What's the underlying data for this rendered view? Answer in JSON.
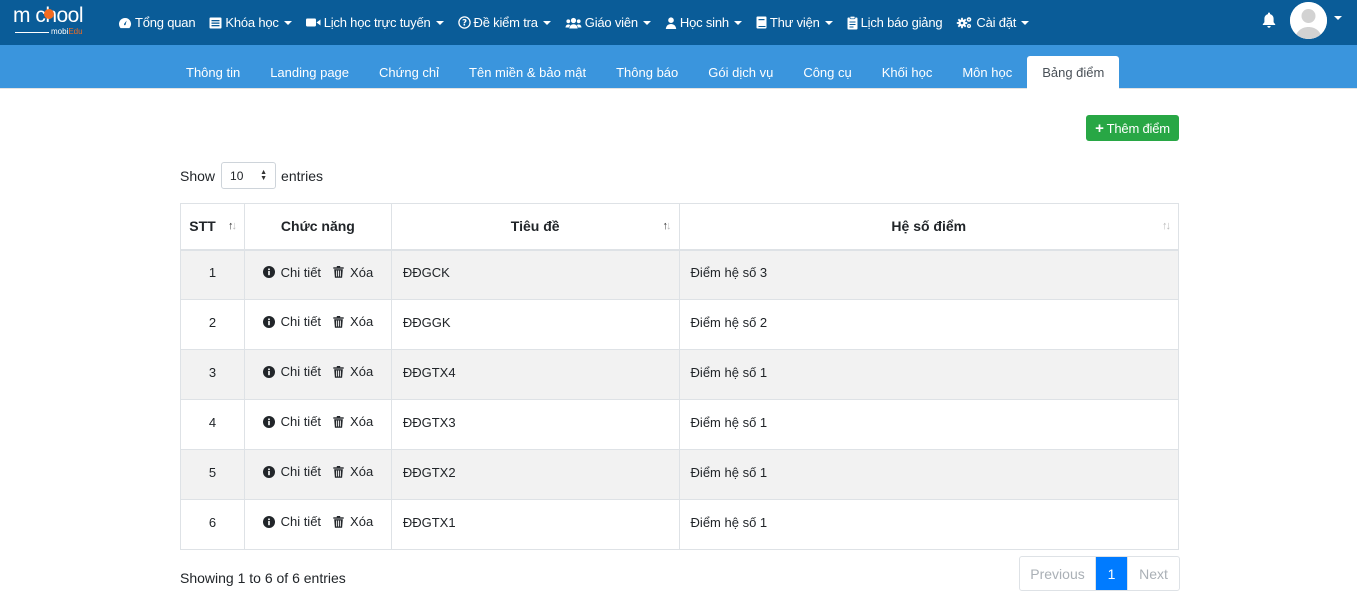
{
  "logo": {
    "text": "m chool",
    "sub_prefix": "",
    "sub_brand_a": "mobi",
    "sub_brand_b": "Edu"
  },
  "topnav": [
    {
      "label": "Tổng quan",
      "icon": "dashboard-icon",
      "dropdown": false
    },
    {
      "label": "Khóa học",
      "icon": "list-icon",
      "dropdown": true
    },
    {
      "label": "Lịch học trực tuyến",
      "icon": "video-icon",
      "dropdown": true
    },
    {
      "label": "Đề kiểm tra",
      "icon": "question-circle-icon",
      "dropdown": true
    },
    {
      "label": "Giáo viên",
      "icon": "users-icon",
      "dropdown": true
    },
    {
      "label": "Học sinh",
      "icon": "user-icon",
      "dropdown": true
    },
    {
      "label": "Thư viện",
      "icon": "book-icon",
      "dropdown": true
    },
    {
      "label": "Lịch báo giảng",
      "icon": "clipboard-icon",
      "dropdown": false
    },
    {
      "label": "Cài đặt",
      "icon": "cogs-icon",
      "dropdown": true
    }
  ],
  "tabs": [
    {
      "label": "Thông tin",
      "active": false
    },
    {
      "label": "Landing page",
      "active": false
    },
    {
      "label": "Chứng chỉ",
      "active": false
    },
    {
      "label": "Tên miền & bảo mật",
      "active": false
    },
    {
      "label": "Thông báo",
      "active": false
    },
    {
      "label": "Gói dịch vụ",
      "active": false
    },
    {
      "label": "Công cụ",
      "active": false
    },
    {
      "label": "Khối học",
      "active": false
    },
    {
      "label": "Môn học",
      "active": false
    },
    {
      "label": "Bảng điểm",
      "active": true
    }
  ],
  "add_button": "Thêm điểm",
  "length": {
    "show": "Show",
    "value": "10",
    "entries": "entries"
  },
  "table": {
    "headers": [
      "STT",
      "Chức năng",
      "Tiêu đề",
      "Hệ số điểm"
    ],
    "action_detail": "Chi tiết",
    "action_delete": "Xóa",
    "rows": [
      {
        "stt": "1",
        "title": "ĐĐGCK",
        "coef": "Điểm hệ số 3"
      },
      {
        "stt": "2",
        "title": "ĐĐGGK",
        "coef": "Điểm hệ số 2"
      },
      {
        "stt": "3",
        "title": "ĐĐGTX4",
        "coef": "Điểm hệ số 1"
      },
      {
        "stt": "4",
        "title": "ĐĐGTX3",
        "coef": "Điểm hệ số 1"
      },
      {
        "stt": "5",
        "title": "ĐĐGTX2",
        "coef": "Điểm hệ số 1"
      },
      {
        "stt": "6",
        "title": "ĐĐGTX1",
        "coef": "Điểm hệ số 1"
      }
    ]
  },
  "info": "Showing 1 to 6 of 6 entries",
  "pager": {
    "previous": "Previous",
    "current": "1",
    "next": "Next"
  },
  "colors": {
    "navbar": "#0a5c98",
    "subbar": "#3a95dd",
    "add": "#28a745",
    "page_active": "#007bff"
  }
}
